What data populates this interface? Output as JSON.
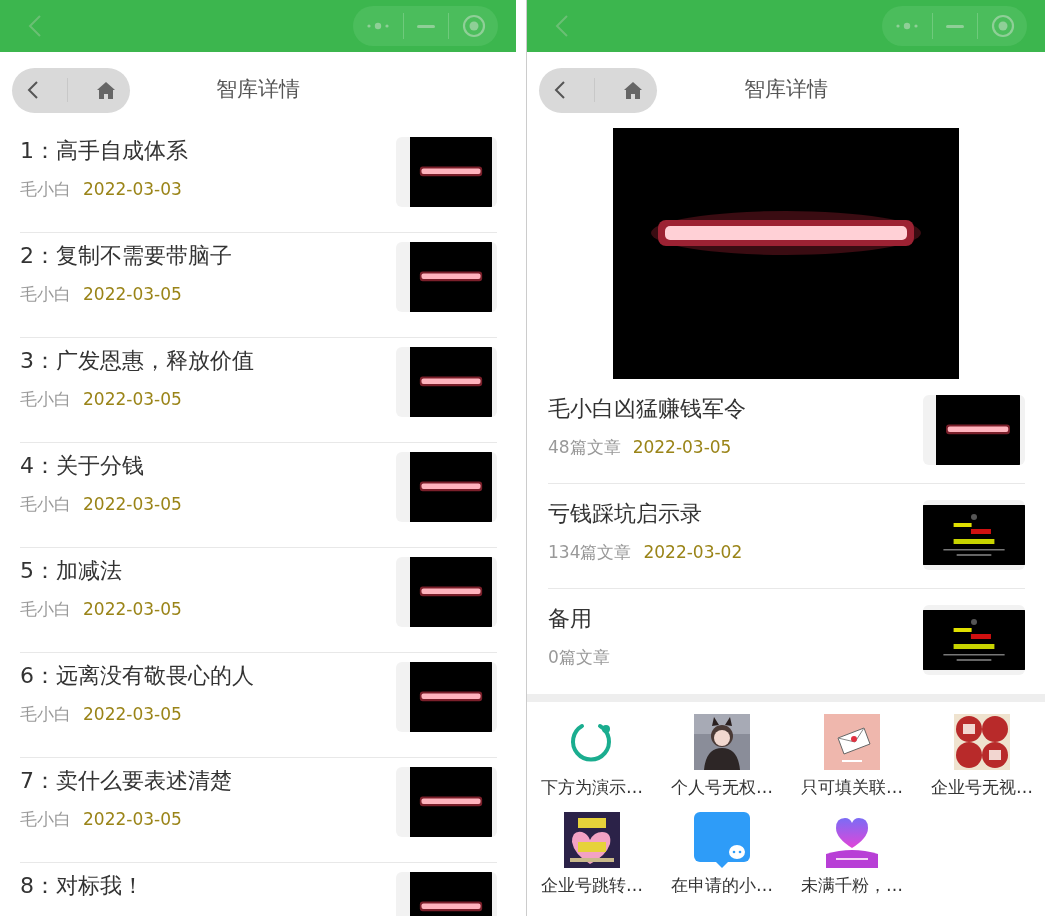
{
  "left_panel": {
    "header": {
      "title": "智库详情"
    },
    "articles": [
      {
        "title": "1：高手自成体系",
        "author": "毛小白",
        "date": "2022-03-03"
      },
      {
        "title": "2：复制不需要带脑子",
        "author": "毛小白",
        "date": "2022-03-05"
      },
      {
        "title": "3：广发恩惠，释放价值",
        "author": "毛小白",
        "date": "2022-03-05"
      },
      {
        "title": "4：关于分钱",
        "author": "毛小白",
        "date": "2022-03-05"
      },
      {
        "title": "5：加减法",
        "author": "毛小白",
        "date": "2022-03-05"
      },
      {
        "title": "6：远离没有敬畏心的人",
        "author": "毛小白",
        "date": "2022-03-05"
      },
      {
        "title": "7：卖什么要表述清楚",
        "author": "毛小白",
        "date": "2022-03-05"
      },
      {
        "title": "8：对标我！"
      }
    ]
  },
  "right_panel": {
    "header": {
      "title": "智库详情"
    },
    "collections": [
      {
        "title": "毛小白凶猛赚钱军令",
        "count": "48篇文章",
        "date": "2022-03-05"
      },
      {
        "title": "亏钱踩坑启示录",
        "count": "134篇文章",
        "date": "2022-03-02"
      },
      {
        "title": "备用",
        "count": "0篇文章"
      }
    ],
    "apps": [
      {
        "label": "下方为演示…",
        "kind": "icon"
      },
      {
        "label": "个人号无权…",
        "kind": "picture"
      },
      {
        "label": "只可填关联…",
        "kind": "picture"
      },
      {
        "label": "企业号无视…",
        "kind": "picture"
      },
      {
        "label": "企业号跳转…",
        "kind": "picture"
      },
      {
        "label": "在申请的小…",
        "kind": "icon"
      },
      {
        "label": "未满千粉，…",
        "kind": "icon"
      }
    ]
  }
}
